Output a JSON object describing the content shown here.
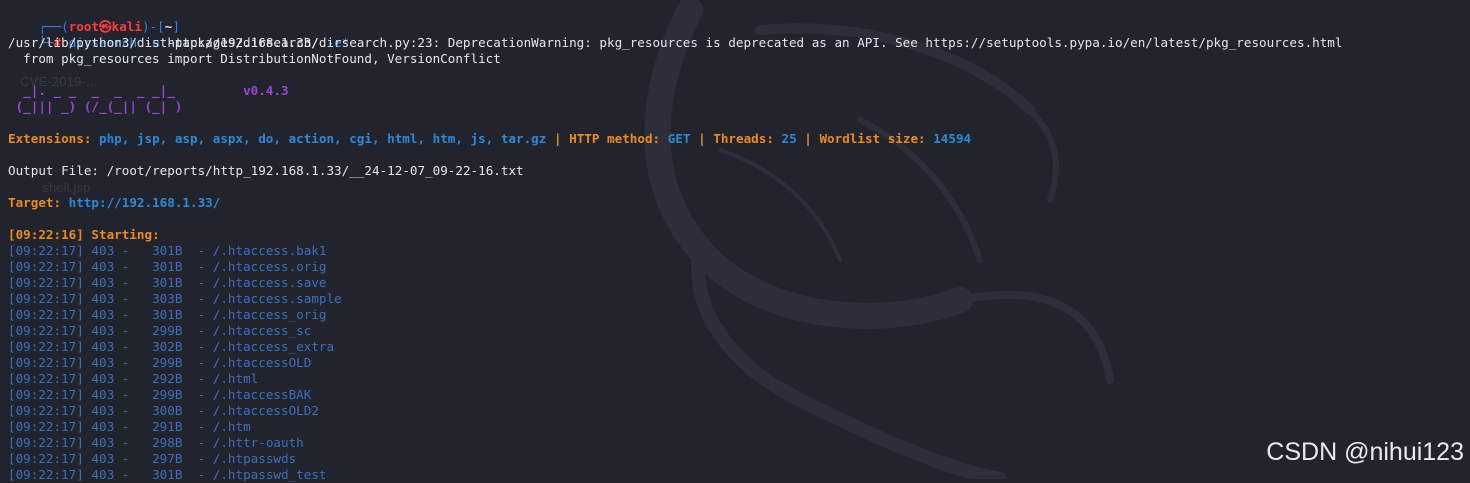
{
  "terminal": {
    "prompt_user": "root",
    "prompt_at": "㉿",
    "prompt_host": "kali",
    "prompt_dir": "~",
    "prompt_symbol": "#",
    "command_name": "dirsearch",
    "command_flag_u": "-u",
    "command_url": "http://192.168.1.33/",
    "command_flag_e": "-e*",
    "warning_line1": "/usr/lib/python3/dist-packages/dirsearch/dirsearch.py:23: DeprecationWarning: pkg_resources is deprecated as an API. See https://setuptools.pypa.io/en/latest/pkg_resources.html",
    "warning_line2": "  from pkg_resources import DistributionNotFound, VersionConflict",
    "logo_line1": "  _|. _ _  _  _  _ _|_",
    "logo_line2": " (_||| _) (/_(_|| (_| )",
    "version": "v0.4.3",
    "ext_label": "Extensions:",
    "ext_values": "php, jsp, asp, aspx, do, action, cgi, html, htm, js, tar.gz",
    "method_label": "HTTP method:",
    "method_value": "GET",
    "threads_label": "Threads:",
    "threads_value": "25",
    "wordlist_label": "Wordlist size:",
    "wordlist_value": "14594",
    "separator": "|",
    "output_label": "Output File:",
    "output_path": "/root/reports/http_192.168.1.33/__24-12-07_09-22-16.txt",
    "target_label": "Target:",
    "target_url": "http://192.168.1.33/",
    "start_time": "[09:22:16]",
    "start_label": "Starting:",
    "results": [
      {
        "time": "[09:22:17]",
        "status": "403",
        "size": "301B",
        "path": "/.htaccess.bak1"
      },
      {
        "time": "[09:22:17]",
        "status": "403",
        "size": "301B",
        "path": "/.htaccess.orig"
      },
      {
        "time": "[09:22:17]",
        "status": "403",
        "size": "301B",
        "path": "/.htaccess.save"
      },
      {
        "time": "[09:22:17]",
        "status": "403",
        "size": "303B",
        "path": "/.htaccess.sample"
      },
      {
        "time": "[09:22:17]",
        "status": "403",
        "size": "301B",
        "path": "/.htaccess_orig"
      },
      {
        "time": "[09:22:17]",
        "status": "403",
        "size": "299B",
        "path": "/.htaccess_sc"
      },
      {
        "time": "[09:22:17]",
        "status": "403",
        "size": "302B",
        "path": "/.htaccess_extra"
      },
      {
        "time": "[09:22:17]",
        "status": "403",
        "size": "299B",
        "path": "/.htaccessOLD"
      },
      {
        "time": "[09:22:17]",
        "status": "403",
        "size": "292B",
        "path": "/.html"
      },
      {
        "time": "[09:22:17]",
        "status": "403",
        "size": "299B",
        "path": "/.htaccessBAK"
      },
      {
        "time": "[09:22:17]",
        "status": "403",
        "size": "300B",
        "path": "/.htaccessOLD2"
      },
      {
        "time": "[09:22:17]",
        "status": "403",
        "size": "291B",
        "path": "/.htm"
      },
      {
        "time": "[09:22:17]",
        "status": "403",
        "size": "298B",
        "path": "/.httr-oauth"
      },
      {
        "time": "[09:22:17]",
        "status": "403",
        "size": "297B",
        "path": "/.htpasswds"
      },
      {
        "time": "[09:22:17]",
        "status": "403",
        "size": "301B",
        "path": "/.htpasswd_test"
      }
    ]
  },
  "background": {
    "ghost_text_1": "CVE-2019-...",
    "ghost_text_2": "shell.jsp"
  },
  "watermark": "CSDN @nihui123",
  "colors": {
    "background": "#22242d",
    "prompt_blue": "#2f7ef0",
    "prompt_red": "#ff3b3b",
    "orange": "#ee8a1a",
    "cyan": "#2b8ad8",
    "purple": "#9a45d4",
    "result_blue": "#3a6fc0"
  }
}
